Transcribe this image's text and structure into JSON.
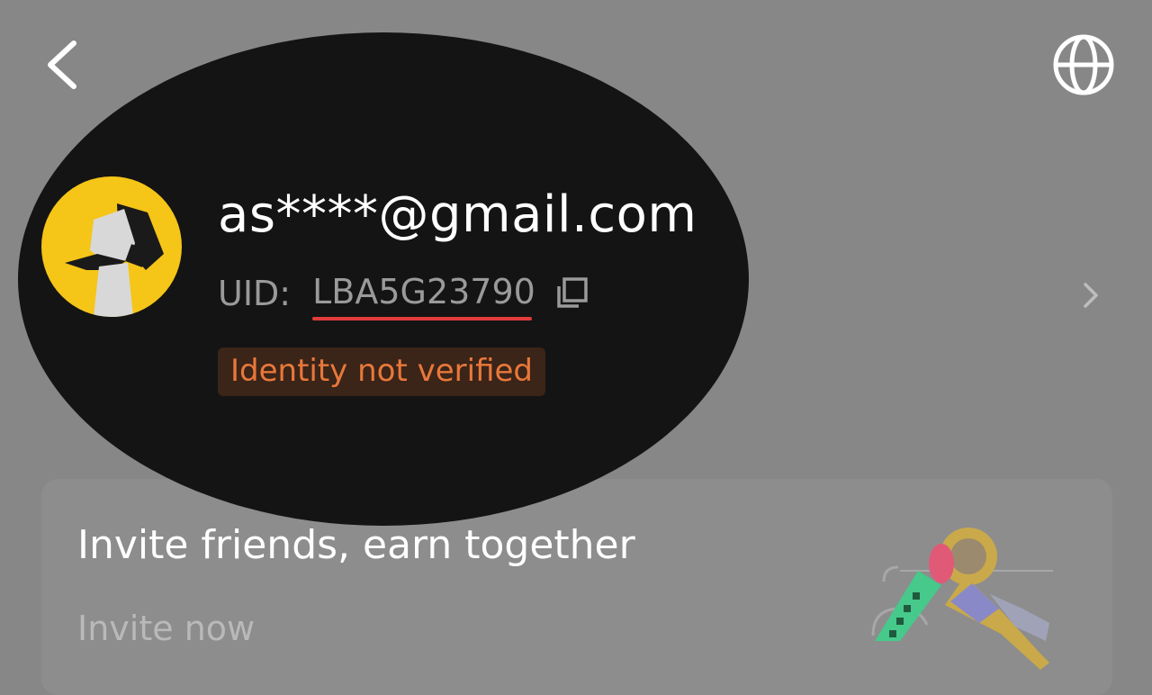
{
  "header": {
    "back_icon": "chevron-left-icon",
    "language_icon": "globe-icon"
  },
  "profile": {
    "avatar": "avatar-icon",
    "email": "as****@gmail.com",
    "uid_label": "UID:",
    "uid_value": "LBA5G23790",
    "copy_icon": "copy-icon",
    "verification_status": "Identity not verified",
    "detail_icon": "chevron-right-icon"
  },
  "invite": {
    "title": "Invite friends, earn together",
    "action": "Invite now",
    "illustration": "key-illustration"
  },
  "colors": {
    "overlay": "#878787",
    "spotlight": "#141414",
    "avatar_bg": "#f5c518",
    "badge_bg": "#3b2418",
    "badge_text": "#e8783a",
    "uid_underline": "#e23b3b"
  }
}
